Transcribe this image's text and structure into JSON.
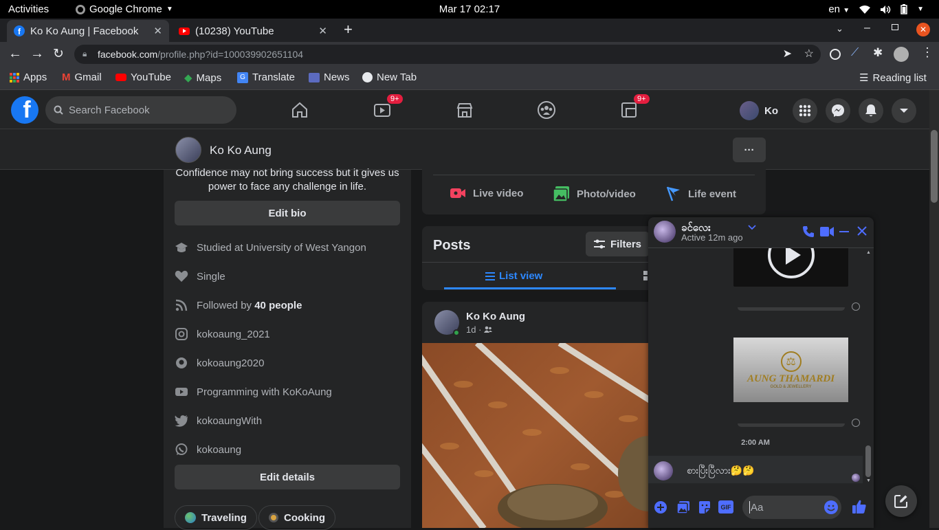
{
  "system": {
    "activities": "Activities",
    "app_name": "Google Chrome",
    "clock": "Mar 17  02:17",
    "lang": "en"
  },
  "browser": {
    "tabs": [
      {
        "title": "Ko Ko Aung | Facebook"
      },
      {
        "title": "(10238) YouTube"
      }
    ],
    "url_domain": "facebook.com",
    "url_path": "/profile.php?id=100039902651104",
    "bookmarks": [
      "Apps",
      "Gmail",
      "YouTube",
      "Maps",
      "Translate",
      "News",
      "New Tab"
    ],
    "reading_list": "Reading list"
  },
  "fb": {
    "search_placeholder": "Search Facebook",
    "watch_badge": "9+",
    "gaming_badge": "9+",
    "profile_short": "Ko",
    "profile_name": "Ko Ko Aung",
    "more": "···"
  },
  "intro": {
    "bio_line1": "Confidence may not bring success but it gives us",
    "bio_line2": "power to face any challenge in life.",
    "edit_bio": "Edit bio",
    "studied": "Studied at University of West Yangon",
    "relationship": "Single",
    "followed_prefix": "Followed by ",
    "followed_count": "40 people",
    "instagram": "kokoaung_2021",
    "github": "kokoaung2020",
    "youtube": "Programming with KoKoAung",
    "twitter": "kokoaungWith",
    "whatsapp": "kokoaung",
    "edit_details": "Edit details",
    "hobbies": [
      "Traveling",
      "Cooking"
    ]
  },
  "composer": {
    "live": "Live video",
    "photo": "Photo/video",
    "life": "Life event"
  },
  "posts": {
    "title": "Posts",
    "filters": "Filters",
    "list_view": "List view"
  },
  "post": {
    "author": "Ko Ko Aung",
    "time": "1d ·"
  },
  "chat": {
    "name": "ခင်လေး",
    "status": "Active 12m ago",
    "brand_text": "AUNG THAMARDI",
    "brand_sub": "GOLD & JEWELLERY",
    "time_divider": "2:00 AM",
    "message": "စားပြီးပြီလား🤔🤔",
    "input_placeholder": "Aa",
    "gif": "GIF"
  },
  "colors": {
    "fb_blue": "#2d88ff",
    "chat_blue": "#4e6dff",
    "bg": "#18191a",
    "surface": "#242526",
    "badge": "#e41e3f"
  }
}
